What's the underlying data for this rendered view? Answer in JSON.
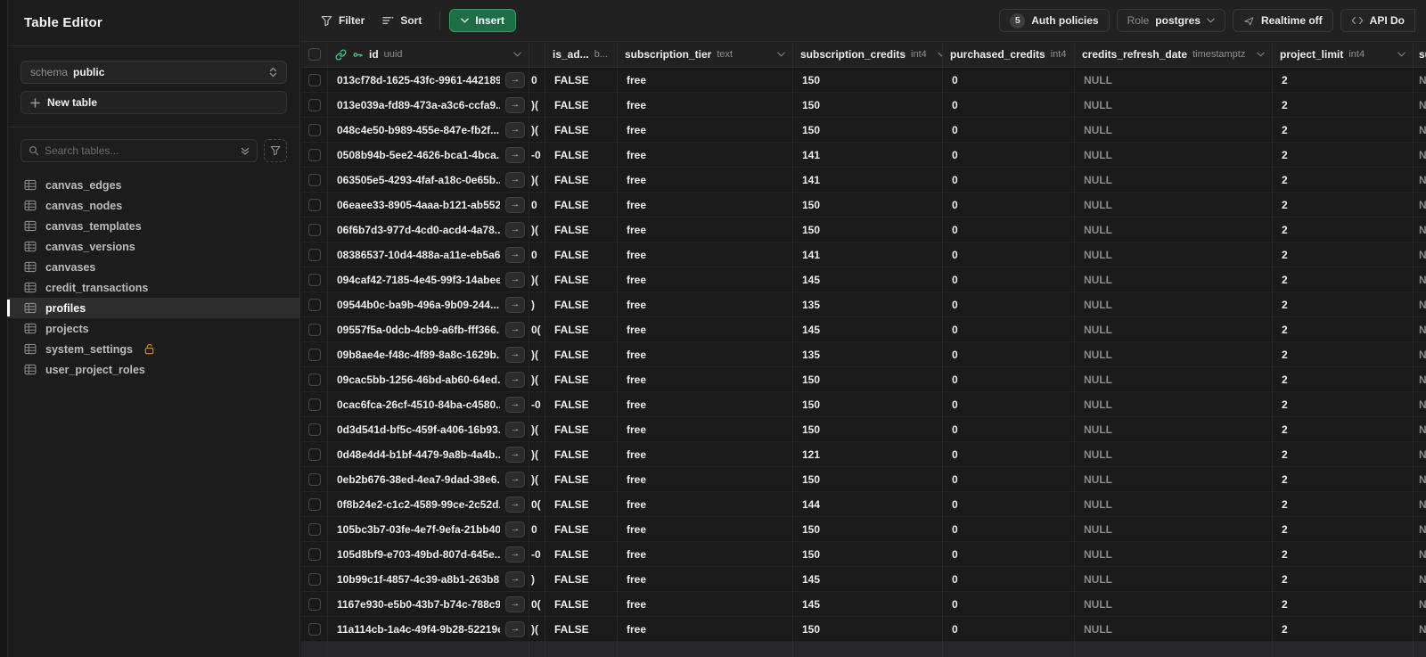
{
  "sidebar": {
    "title": "Table Editor",
    "schema_label": "schema",
    "schema_value": "public",
    "new_table_label": "New table",
    "search_placeholder": "Search tables...",
    "tables": [
      {
        "label": "canvas_edges",
        "selected": false,
        "locked": false
      },
      {
        "label": "canvas_nodes",
        "selected": false,
        "locked": false
      },
      {
        "label": "canvas_templates",
        "selected": false,
        "locked": false
      },
      {
        "label": "canvas_versions",
        "selected": false,
        "locked": false
      },
      {
        "label": "canvases",
        "selected": false,
        "locked": false
      },
      {
        "label": "credit_transactions",
        "selected": false,
        "locked": false
      },
      {
        "label": "profiles",
        "selected": true,
        "locked": false
      },
      {
        "label": "projects",
        "selected": false,
        "locked": false
      },
      {
        "label": "system_settings",
        "selected": false,
        "locked": true
      },
      {
        "label": "user_project_roles",
        "selected": false,
        "locked": false
      }
    ]
  },
  "toolbar": {
    "filter_label": "Filter",
    "sort_label": "Sort",
    "insert_label": "Insert",
    "auth_policies_count": "5",
    "auth_policies_label": "Auth policies",
    "role_label": "Role",
    "role_value": "postgres",
    "realtime_label": "Realtime off",
    "api_docs_label": "API Do"
  },
  "grid": {
    "columns": [
      {
        "name": "id",
        "type": "uuid"
      },
      {
        "name": "",
        "type": ""
      },
      {
        "name": "is_ad...",
        "type": "b..."
      },
      {
        "name": "subscription_tier",
        "type": "text"
      },
      {
        "name": "subscription_credits",
        "type": "int4"
      },
      {
        "name": "purchased_credits",
        "type": "int4"
      },
      {
        "name": "credits_refresh_date",
        "type": "timestamptz"
      },
      {
        "name": "project_limit",
        "type": "int4"
      },
      {
        "name": "su",
        "type": ""
      }
    ],
    "rows": [
      {
        "id": "013cf78d-1625-43fc-9961-442189...",
        "frag": "0",
        "is_admin": "FALSE",
        "tier": "free",
        "sub_credits": "150",
        "purchased": "0",
        "refresh": "NULL",
        "limit": "2",
        "su": "NULL"
      },
      {
        "id": "013e039a-fd89-473a-a3c6-ccfa9...",
        "frag": ")(",
        "is_admin": "FALSE",
        "tier": "free",
        "sub_credits": "150",
        "purchased": "0",
        "refresh": "NULL",
        "limit": "2",
        "su": "NULL"
      },
      {
        "id": "048c4e50-b989-455e-847e-fb2f...",
        "frag": ")(",
        "is_admin": "FALSE",
        "tier": "free",
        "sub_credits": "150",
        "purchased": "0",
        "refresh": "NULL",
        "limit": "2",
        "su": "NULL"
      },
      {
        "id": "0508b94b-5ee2-4626-bca1-4bca...",
        "frag": "-0",
        "is_admin": "FALSE",
        "tier": "free",
        "sub_credits": "141",
        "purchased": "0",
        "refresh": "NULL",
        "limit": "2",
        "su": "NULL"
      },
      {
        "id": "063505e5-4293-4faf-a18c-0e65b...",
        "frag": ")(",
        "is_admin": "FALSE",
        "tier": "free",
        "sub_credits": "141",
        "purchased": "0",
        "refresh": "NULL",
        "limit": "2",
        "su": "NULL"
      },
      {
        "id": "06eaee33-8905-4aaa-b121-ab552...",
        "frag": "0",
        "is_admin": "FALSE",
        "tier": "free",
        "sub_credits": "150",
        "purchased": "0",
        "refresh": "NULL",
        "limit": "2",
        "su": "NULL"
      },
      {
        "id": "06f6b7d3-977d-4cd0-acd4-4a78...",
        "frag": ")(",
        "is_admin": "FALSE",
        "tier": "free",
        "sub_credits": "150",
        "purchased": "0",
        "refresh": "NULL",
        "limit": "2",
        "su": "NULL"
      },
      {
        "id": "08386537-10d4-488a-a11e-eb5a6...",
        "frag": "0",
        "is_admin": "FALSE",
        "tier": "free",
        "sub_credits": "141",
        "purchased": "0",
        "refresh": "NULL",
        "limit": "2",
        "su": "NULL"
      },
      {
        "id": "094caf42-7185-4e45-99f3-14abee...",
        "frag": ")(",
        "is_admin": "FALSE",
        "tier": "free",
        "sub_credits": "145",
        "purchased": "0",
        "refresh": "NULL",
        "limit": "2",
        "su": "NULL"
      },
      {
        "id": "09544b0c-ba9b-496a-9b09-244...",
        "frag": ")",
        "is_admin": "FALSE",
        "tier": "free",
        "sub_credits": "135",
        "purchased": "0",
        "refresh": "NULL",
        "limit": "2",
        "su": "NULL"
      },
      {
        "id": "09557f5a-0dcb-4cb9-a6fb-fff366...",
        "frag": "0(",
        "is_admin": "FALSE",
        "tier": "free",
        "sub_credits": "145",
        "purchased": "0",
        "refresh": "NULL",
        "limit": "2",
        "su": "NULL"
      },
      {
        "id": "09b8ae4e-f48c-4f89-8a8c-1629b...",
        "frag": ")(",
        "is_admin": "FALSE",
        "tier": "free",
        "sub_credits": "135",
        "purchased": "0",
        "refresh": "NULL",
        "limit": "2",
        "su": "NULL"
      },
      {
        "id": "09cac5bb-1256-46bd-ab60-64ed...",
        "frag": ")(",
        "is_admin": "FALSE",
        "tier": "free",
        "sub_credits": "150",
        "purchased": "0",
        "refresh": "NULL",
        "limit": "2",
        "su": "NULL"
      },
      {
        "id": "0cac6fca-26cf-4510-84ba-c4580...",
        "frag": "-0",
        "is_admin": "FALSE",
        "tier": "free",
        "sub_credits": "150",
        "purchased": "0",
        "refresh": "NULL",
        "limit": "2",
        "su": "NULL"
      },
      {
        "id": "0d3d541d-bf5c-459f-a406-16b93...",
        "frag": ")(",
        "is_admin": "FALSE",
        "tier": "free",
        "sub_credits": "150",
        "purchased": "0",
        "refresh": "NULL",
        "limit": "2",
        "su": "NULL"
      },
      {
        "id": "0d48e4d4-b1bf-4479-9a8b-4a4b...",
        "frag": ")(",
        "is_admin": "FALSE",
        "tier": "free",
        "sub_credits": "121",
        "purchased": "0",
        "refresh": "NULL",
        "limit": "2",
        "su": "NULL"
      },
      {
        "id": "0eb2b676-38ed-4ea7-9dad-38e6...",
        "frag": ")(",
        "is_admin": "FALSE",
        "tier": "free",
        "sub_credits": "150",
        "purchased": "0",
        "refresh": "NULL",
        "limit": "2",
        "su": "NULL"
      },
      {
        "id": "0f8b24e2-c1c2-4589-99ce-2c52d...",
        "frag": "0(",
        "is_admin": "FALSE",
        "tier": "free",
        "sub_credits": "144",
        "purchased": "0",
        "refresh": "NULL",
        "limit": "2",
        "su": "NULL"
      },
      {
        "id": "105bc3b7-03fe-4e7f-9efa-21bb40...",
        "frag": "0",
        "is_admin": "FALSE",
        "tier": "free",
        "sub_credits": "150",
        "purchased": "0",
        "refresh": "NULL",
        "limit": "2",
        "su": "NULL"
      },
      {
        "id": "105d8bf9-e703-49bd-807d-645e...",
        "frag": "-0",
        "is_admin": "FALSE",
        "tier": "free",
        "sub_credits": "150",
        "purchased": "0",
        "refresh": "NULL",
        "limit": "2",
        "su": "NULL"
      },
      {
        "id": "10b99c1f-4857-4c39-a8b1-263b8...",
        "frag": ")",
        "is_admin": "FALSE",
        "tier": "free",
        "sub_credits": "145",
        "purchased": "0",
        "refresh": "NULL",
        "limit": "2",
        "su": "NULL"
      },
      {
        "id": "1167e930-e5b0-43b7-b74c-788c9...",
        "frag": "0(",
        "is_admin": "FALSE",
        "tier": "free",
        "sub_credits": "145",
        "purchased": "0",
        "refresh": "NULL",
        "limit": "2",
        "su": "NULL"
      },
      {
        "id": "11a114cb-1a4c-49f4-9b28-52219ec...",
        "frag": ")(",
        "is_admin": "FALSE",
        "tier": "free",
        "sub_credits": "150",
        "purchased": "0",
        "refresh": "NULL",
        "limit": "2",
        "su": "NULL"
      }
    ]
  },
  "colors": {
    "accent_green": "#3ecf8e",
    "insert_button_bg": "#1d6e47",
    "lock_orange": "#c9842c",
    "null_gray": "#8a8a8a",
    "sidebar_bg": "#1c1c1c",
    "row_bg": "#1a1a1a"
  }
}
